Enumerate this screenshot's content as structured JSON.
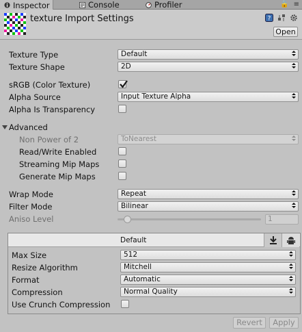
{
  "tabs": [
    {
      "label": "Inspector",
      "icon": "info-icon",
      "active": true
    },
    {
      "label": "Console",
      "icon": "console-icon",
      "active": false
    },
    {
      "label": "Profiler",
      "icon": "profiler-icon",
      "active": false
    }
  ],
  "header": {
    "title": "texture Import Settings",
    "open_label": "Open"
  },
  "fields": {
    "texture_type": {
      "label": "Texture Type",
      "value": "Default"
    },
    "texture_shape": {
      "label": "Texture Shape",
      "value": "2D"
    },
    "srgb": {
      "label": "sRGB (Color Texture)",
      "checked": true
    },
    "alpha_source": {
      "label": "Alpha Source",
      "value": "Input Texture Alpha"
    },
    "alpha_is_transparency": {
      "label": "Alpha Is Transparency",
      "checked": false
    },
    "advanced": {
      "label": "Advanced",
      "expanded": true
    },
    "non_power_of_2": {
      "label": "Non Power of 2",
      "value": "ToNearest",
      "disabled": true
    },
    "read_write": {
      "label": "Read/Write Enabled",
      "checked": false
    },
    "streaming_mip": {
      "label": "Streaming Mip Maps",
      "checked": false
    },
    "generate_mip": {
      "label": "Generate Mip Maps",
      "checked": false
    },
    "wrap_mode": {
      "label": "Wrap Mode",
      "value": "Repeat"
    },
    "filter_mode": {
      "label": "Filter Mode",
      "value": "Bilinear"
    },
    "aniso_level": {
      "label": "Aniso Level",
      "value": "1",
      "disabled": true
    }
  },
  "platform": {
    "header_label": "Default",
    "tabs": [
      "download-icon",
      "android-icon"
    ],
    "max_size": {
      "label": "Max Size",
      "value": "512"
    },
    "resize_algorithm": {
      "label": "Resize Algorithm",
      "value": "Mitchell"
    },
    "format": {
      "label": "Format",
      "value": "Automatic"
    },
    "compression": {
      "label": "Compression",
      "value": "Normal Quality"
    },
    "use_crunch": {
      "label": "Use Crunch Compression",
      "checked": false
    }
  },
  "footer": {
    "revert_label": "Revert",
    "apply_label": "Apply"
  },
  "colors": {
    "background": "#c2c2c2",
    "check_mark": "#1a1a1a"
  }
}
